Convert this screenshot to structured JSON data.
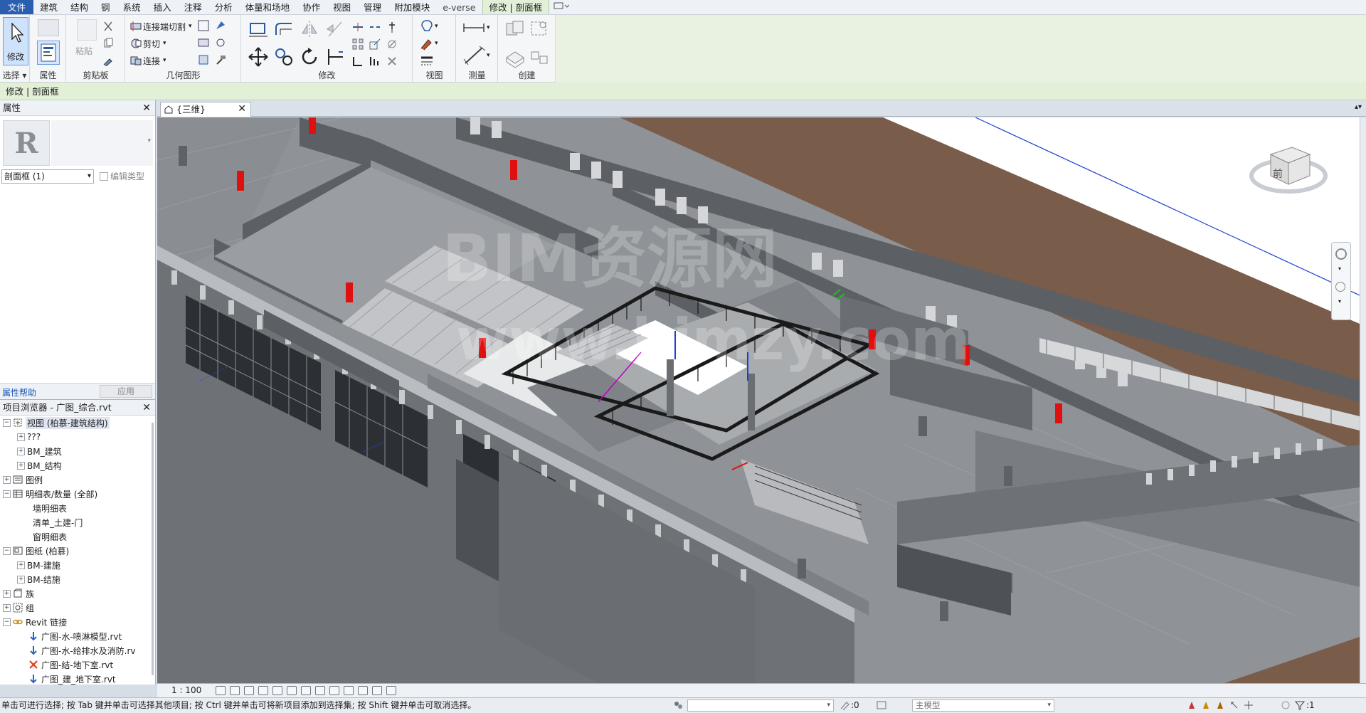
{
  "menu": {
    "tabs": [
      "文件",
      "建筑",
      "结构",
      "钢",
      "系统",
      "插入",
      "注释",
      "分析",
      "体量和场地",
      "协作",
      "视图",
      "管理",
      "附加模块",
      "e-verse",
      "修改 | 剖面框"
    ]
  },
  "ribbon": {
    "select_panel": {
      "button": "修改",
      "title": "选择 ▾"
    },
    "properties_panel": {
      "title": "属性"
    },
    "clipboard_panel": {
      "paste": "粘贴",
      "title": "剪贴板"
    },
    "geometry_panel": {
      "cope": "连接端切割",
      "cut": "剪切",
      "join": "连接",
      "title": "几何图形"
    },
    "modify_panel": {
      "title": "修改"
    },
    "view_panel": {
      "title": "视图"
    },
    "measure_panel": {
      "title": "测量"
    },
    "create_panel": {
      "title": "创建"
    }
  },
  "context_bar": {
    "text": "修改 | 剖面框"
  },
  "properties": {
    "title": "属性",
    "instance_selector": "剖面框 (1)",
    "edit_type": "编辑类型",
    "help": "属性帮助",
    "apply": "应用"
  },
  "browser": {
    "title": "项目浏览器 - 广图_综合.rvt",
    "nodes": [
      {
        "label": "视图 (柏慕-建筑结构)"
      },
      {
        "label": "???"
      },
      {
        "label": "BM_建筑"
      },
      {
        "label": "BM_结构"
      },
      {
        "label": "图例"
      },
      {
        "label": "明细表/数量 (全部)"
      },
      {
        "label": "墙明细表"
      },
      {
        "label": "清单_土建-门"
      },
      {
        "label": "窗明细表"
      },
      {
        "label": "图纸 (柏慕)"
      },
      {
        "label": "BM-建施"
      },
      {
        "label": "BM-结施"
      },
      {
        "label": "族"
      },
      {
        "label": "组"
      },
      {
        "label": "Revit 链接"
      },
      {
        "label": "广图-水-喷淋模型.rvt"
      },
      {
        "label": "广图-水-给排水及消防.rv"
      },
      {
        "label": "广图-结-地下室.rvt"
      },
      {
        "label": "广图_建_地下室.rvt"
      }
    ]
  },
  "view": {
    "tab_label": "{三维}",
    "viewcube_face": "前",
    "watermark_1": "BIM资源网",
    "watermark_2": "www.bimzy.com",
    "scale": "1 : 100"
  },
  "status": {
    "text": "单击可进行选择; 按 Tab 键并单击可选择其他项目; 按 Ctrl 键并单击可将新项目添加到选择集; 按 Shift 键并单击可取消选择。",
    "design_option_value": ":0",
    "model_value": "主模型",
    "filter_value": ":1"
  },
  "colors": {
    "file_tab": "#2a5fb0",
    "context_green": "#e3f0d8",
    "ground_brown": "#7a5c4a",
    "slab_gray": "#8c8f94",
    "door_red": "#e01010"
  }
}
